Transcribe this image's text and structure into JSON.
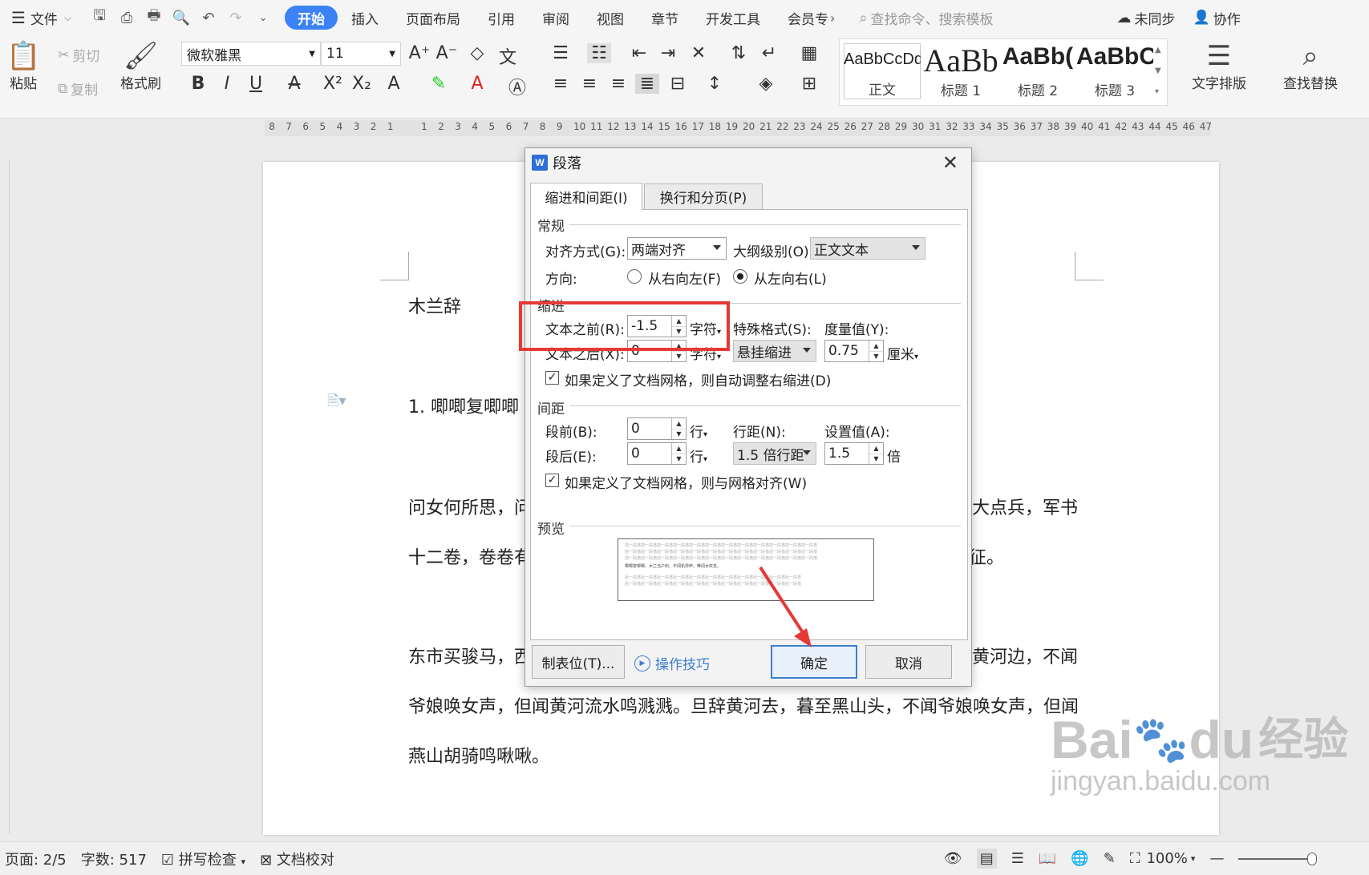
{
  "menubar": {
    "file_label": "文件",
    "tabs": [
      "开始",
      "插入",
      "页面布局",
      "引用",
      "审阅",
      "视图",
      "章节",
      "开发工具",
      "会员专"
    ],
    "more": "›",
    "search_placeholder": "查找命令、搜索模板",
    "sync_label": "未同步",
    "collab_label": "协作"
  },
  "ribbon": {
    "paste_label": "粘贴",
    "cut_label": "剪切",
    "copy_label": "复制",
    "format_painter_label": "格式刷",
    "font_name": "微软雅黑",
    "font_size": "11",
    "styles": [
      {
        "preview": "AaBbCcDd",
        "label": "正文"
      },
      {
        "preview": "AaBb",
        "label": "标题 1"
      },
      {
        "preview": "AaBb(",
        "label": "标题 2"
      },
      {
        "preview": "AaBbC",
        "label": "标题 3"
      }
    ],
    "text_layout_label": "文字排版",
    "find_replace_label": "查找替换"
  },
  "ruler": {
    "left_numbers": [
      "8",
      "7",
      "6",
      "5",
      "4",
      "3",
      "2",
      "1"
    ],
    "right_numbers": [
      "1",
      "2",
      "3",
      "4",
      "5",
      "6",
      "7",
      "8",
      "9",
      "10",
      "11",
      "12",
      "13",
      "14",
      "15",
      "16",
      "17",
      "18",
      "19",
      "20",
      "21",
      "22",
      "23",
      "24",
      "25",
      "26",
      "27",
      "28",
      "29",
      "30",
      "31",
      "32",
      "33",
      "34",
      "35",
      "36",
      "37",
      "38",
      "39",
      "40",
      "41",
      "42",
      "43",
      "44",
      "45",
      "46",
      "47"
    ]
  },
  "document": {
    "title": "木兰辞",
    "list_item": "1.    唧唧复唧唧",
    "line1_left": "问女何所思，问",
    "line1_right": "大点兵，军书",
    "line2_left": "十二卷，卷卷有",
    "line2_right": "征。",
    "line3_left": "东市买骏马，西",
    "line3_right": "黄河边，不闻",
    "line4": "爷娘唤女声，但闻黄河流水鸣溅溅。旦辞黄河去，暮至黑山头，不闻爷娘唤女声，但闻",
    "line5": "燕山胡骑鸣啾啾。"
  },
  "status": {
    "page": "页面: 2/5",
    "words": "字数: 517",
    "spellcheck": "拼写检查",
    "doc_review": "文档校对",
    "zoom": "100%"
  },
  "dialog": {
    "title": "段落",
    "tab_indent": "缩进和间距(I)",
    "tab_linebreak": "换行和分页(P)",
    "general": {
      "heading": "常规",
      "align_label": "对齐方式(G):",
      "align_value": "两端对齐",
      "outline_label": "大纲级别(O):",
      "outline_value": "正文文本",
      "direction_label": "方向:",
      "rtl_label": "从右向左(F)",
      "ltr_label": "从左向右(L)"
    },
    "indent": {
      "heading": "缩进",
      "before_label": "文本之前(R):",
      "before_value": "-1.5",
      "before_unit": "字符",
      "after_label": "文本之后(X):",
      "after_value": "0",
      "after_unit": "字符",
      "special_label": "特殊格式(S):",
      "special_value": "悬挂缩进",
      "measure_label": "度量值(Y):",
      "measure_value": "0.75",
      "measure_unit": "厘米",
      "grid_checkbox": "如果定义了文档网格，则自动调整右缩进(D)"
    },
    "spacing": {
      "heading": "间距",
      "before_label": "段前(B):",
      "before_value": "0",
      "before_unit": "行",
      "after_label": "段后(E):",
      "after_value": "0",
      "after_unit": "行",
      "line_label": "行距(N):",
      "line_value": "1.5 倍行距",
      "setting_label": "设置值(A):",
      "setting_value": "1.5",
      "setting_unit": "倍",
      "grid_checkbox": "如果定义了文档网格，则与网格对齐(W)"
    },
    "preview": {
      "heading": "预览",
      "sample_before": "前一段落前一段落前一段落前一段落前一段落前一段落前一段落前一段落前一段落前一段落前一段落前一段落",
      "sample_current": "唧唧复唧唧，木兰当户织。不闻机杼声，唯闻女叹息。",
      "sample_after": "后一段落后一段落后一段落后一段落后一段落后一段落后一段落后一段落后一段落后一段落后一段落"
    },
    "tabs_button": "制表位(T)...",
    "tips_label": "操作技巧",
    "ok_button": "确定",
    "cancel_button": "取消"
  },
  "watermark": {
    "brand": "Bai",
    "brand2": "du",
    "brand_cn": "经验",
    "url": "jingyan.baidu.com"
  }
}
